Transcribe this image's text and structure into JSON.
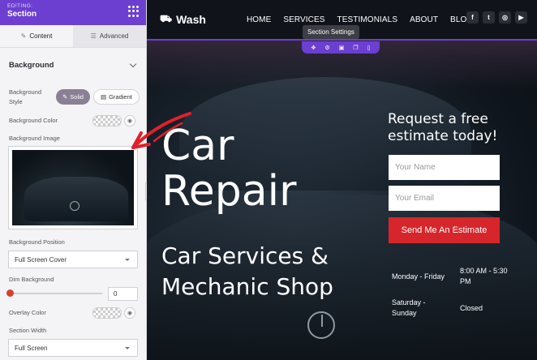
{
  "panel": {
    "editing_label": "EDITING:",
    "title": "Section",
    "tabs": [
      {
        "label": "Content",
        "icon": "pencil-icon",
        "active": true
      },
      {
        "label": "Advanced",
        "icon": "sliders-icon",
        "active": false
      }
    ],
    "section_title": "Background",
    "background_style_label": "Background Style",
    "style_options": [
      "Solid",
      "Gradient"
    ],
    "style_selected": "Solid",
    "background_color_label": "Background Color",
    "background_image_label": "Background Image",
    "background_position_label": "Background Position",
    "background_position_value": "Full Screen Cover",
    "dim_background_label": "Dim Background",
    "dim_background_value": "0",
    "overlay_color_label": "Overlay Color",
    "section_width_label": "Section Width",
    "section_width_value": "Full Screen"
  },
  "preview": {
    "brand": "Wash",
    "menu": [
      "HOME",
      "SERVICES",
      "TESTIMONIALS",
      "ABOUT",
      "BLOG"
    ],
    "socials": [
      "facebook-icon",
      "twitter-icon",
      "instagram-icon",
      "youtube-icon"
    ],
    "tooltip": "Section Settings",
    "headline_line1": "Car",
    "headline_line2": "Repair",
    "subheadline_line1": "Car Services &",
    "subheadline_line2": "Mechanic Shop",
    "form_title_line1": "Request a free",
    "form_title_line2": "estimate today!",
    "name_placeholder": "Your Name",
    "email_placeholder": "Your Email",
    "cta_label": "Send Me An Estimate",
    "hours": [
      {
        "day": "Monday - Friday",
        "time_line1": "8:00 AM - 5:30",
        "time_line2": "PM"
      },
      {
        "day_line1": "Saturday -",
        "day_line2": "Sunday",
        "time": "Closed"
      }
    ]
  },
  "colors": {
    "accent": "#6c3fd1",
    "cta": "#d6262b",
    "annotation_arrow": "#e0202a"
  }
}
